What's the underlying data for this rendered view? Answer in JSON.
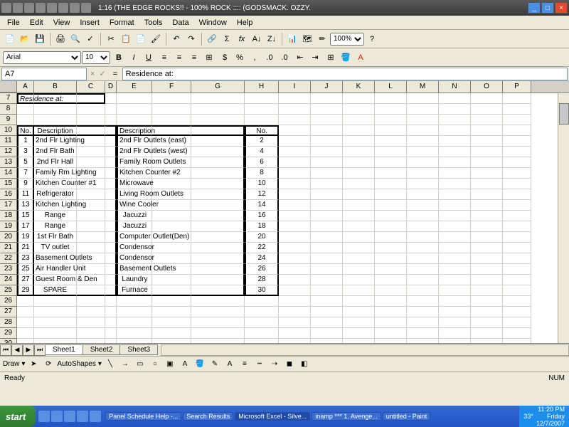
{
  "title": "1:16  (THE EDGE ROCKS!! - 100% ROCK :::: (GODSMACK.  OZZY.",
  "menubar": [
    "File",
    "Edit",
    "View",
    "Insert",
    "Format",
    "Tools",
    "Data",
    "Window",
    "Help"
  ],
  "zoom": "100%",
  "font": {
    "name": "Arial",
    "size": "10"
  },
  "namebox": "A7",
  "formula": "Residence at:",
  "columns": [
    "A",
    "B",
    "C",
    "D",
    "E",
    "F",
    "G",
    "H",
    "I",
    "J",
    "K",
    "L",
    "M",
    "N",
    "O",
    "P"
  ],
  "row7_text": "Residence at:",
  "table": {
    "headers": {
      "no": "No.",
      "desc": "Description"
    },
    "rows": [
      {
        "n1": "1",
        "d1": "2nd Flr Lighting",
        "d2": "2nd Flr Outlets (east)",
        "n2": "2"
      },
      {
        "n1": "3",
        "d1": "2nd Flr Bath",
        "d2": "2nd Flr Outlets (west)",
        "n2": "4"
      },
      {
        "n1": "5",
        "d1": "2nd Flr Hall",
        "d2": "Family Room Outlets",
        "n2": "6"
      },
      {
        "n1": "7",
        "d1": "Family Rm Lighting",
        "d2": "Kitchen Counter #2",
        "n2": "8"
      },
      {
        "n1": "9",
        "d1": "Kitchen Counter #1",
        "d2": "Microwave",
        "n2": "10"
      },
      {
        "n1": "11",
        "d1": "Refrigerator",
        "d2": "Living Room Outlets",
        "n2": "12"
      },
      {
        "n1": "13",
        "d1": "Kitchen Lighting",
        "d2": "Wine Cooler",
        "n2": "14"
      },
      {
        "n1": "15",
        "d1": "Range",
        "d2": "Jacuzzi",
        "n2": "16"
      },
      {
        "n1": "17",
        "d1": "Range",
        "d2": "Jacuzzi",
        "n2": "18"
      },
      {
        "n1": "19",
        "d1": "1st Flr Bath",
        "d2": "Computer Outlet(Den)",
        "n2": "20"
      },
      {
        "n1": "21",
        "d1": "TV outlet",
        "d2": "Condensor",
        "n2": "22"
      },
      {
        "n1": "23",
        "d1": "Basement Outlets",
        "d2": "Condensor",
        "n2": "24"
      },
      {
        "n1": "25",
        "d1": "Air Handler Unit",
        "d2": "Basement Outlets",
        "n2": "26"
      },
      {
        "n1": "27",
        "d1": "Guest Room & Den",
        "d2": "Laundry",
        "n2": "28"
      },
      {
        "n1": "29",
        "d1": "SPARE",
        "d2": "Furnace",
        "n2": "30"
      }
    ]
  },
  "sheets": [
    "Sheet1",
    "Sheet2",
    "Sheet3"
  ],
  "draw_label": "Draw",
  "autoshapes_label": "AutoShapes",
  "status": {
    "ready": "Ready",
    "num": "NUM"
  },
  "taskbar": {
    "start": "start",
    "tasks": [
      "Panel Schedule Help -...",
      "Search Results",
      "Microsoft Excel - Silve...",
      "inamp *** 1. Avenge...",
      "untitled - Paint"
    ],
    "temp": "33°",
    "time": "11:20 PM",
    "day": "Friday",
    "date": "12/7/2007"
  }
}
